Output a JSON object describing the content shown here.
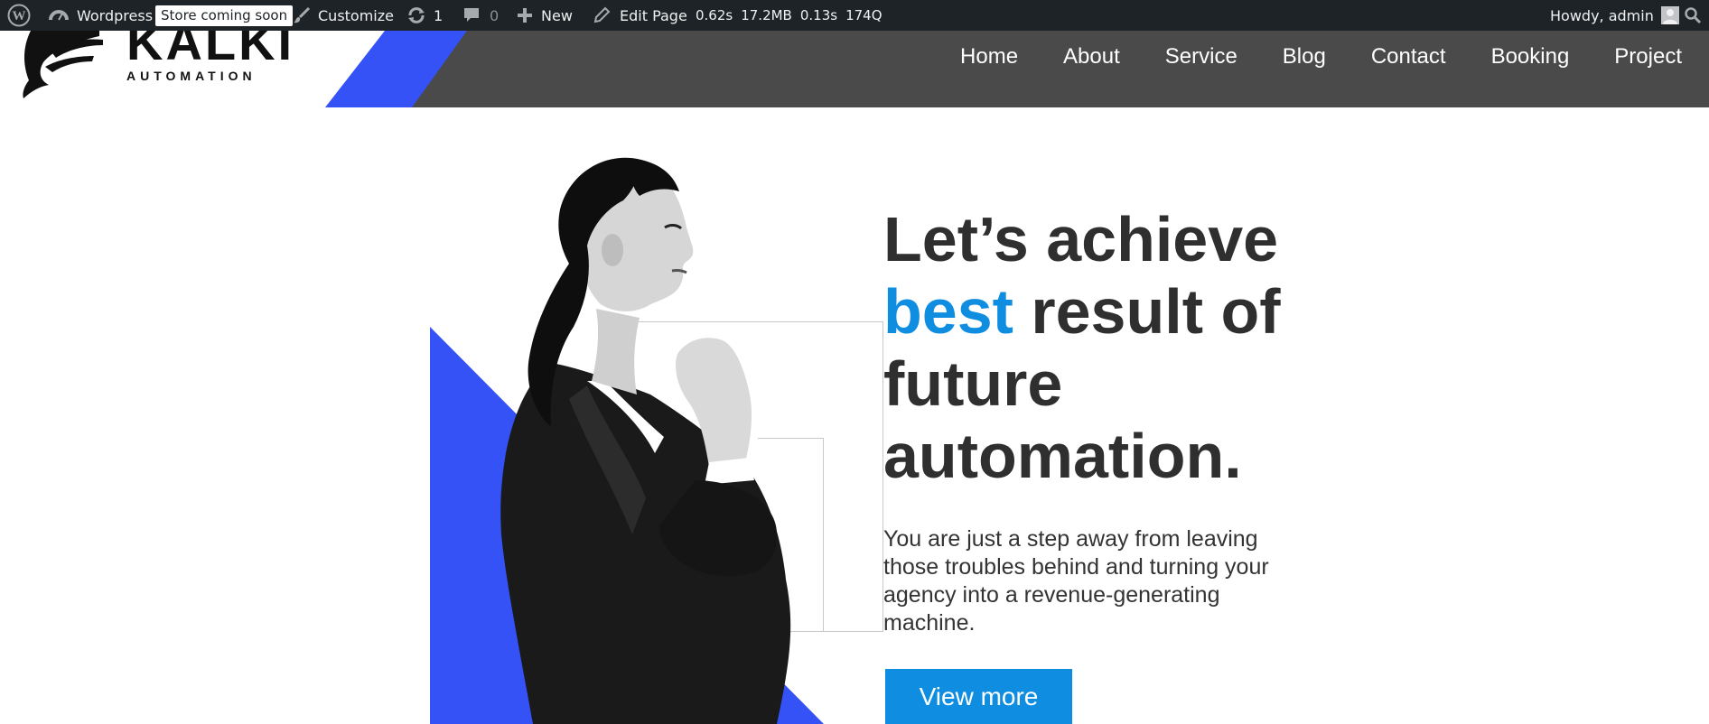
{
  "admin_bar": {
    "site_name": "Wordpress",
    "store_badge": "Store coming soon",
    "customize": "Customize",
    "updates_count": "1",
    "comments_count": "0",
    "new_label": "New",
    "edit_page": "Edit Page",
    "perf": [
      "0.62s",
      "17.2MB",
      "0.13s",
      "174Q"
    ],
    "greeting": "Howdy, admin",
    "icons": [
      "wordpress-logo-icon",
      "dashboard-icon",
      "paintbrush-icon",
      "updates-icon",
      "comment-icon",
      "plus-icon",
      "pencil-icon",
      "avatar",
      "search-icon"
    ]
  },
  "header": {
    "logo_title": "KALKI",
    "logo_subtitle": "AUTOMATION",
    "nav": [
      "Home",
      "About",
      "Service",
      "Blog",
      "Contact",
      "Booking",
      "Project"
    ]
  },
  "hero": {
    "headline_l1": "Let’s achieve",
    "headline_accent": "best",
    "headline_l2_rest": " result of",
    "headline_l3": "future",
    "headline_l4": "automation.",
    "subtext": "You are just a step away from leaving those troubles behind and turning your agency into a revenue-generating machine.",
    "button": "View more"
  },
  "colors": {
    "admin_bar_bg": "#1d2327",
    "header_bg": "#4a4a4a",
    "brand_blue": "#3452f5",
    "accent_blue": "#0f8de0",
    "text_dark": "#2f2f2f"
  }
}
